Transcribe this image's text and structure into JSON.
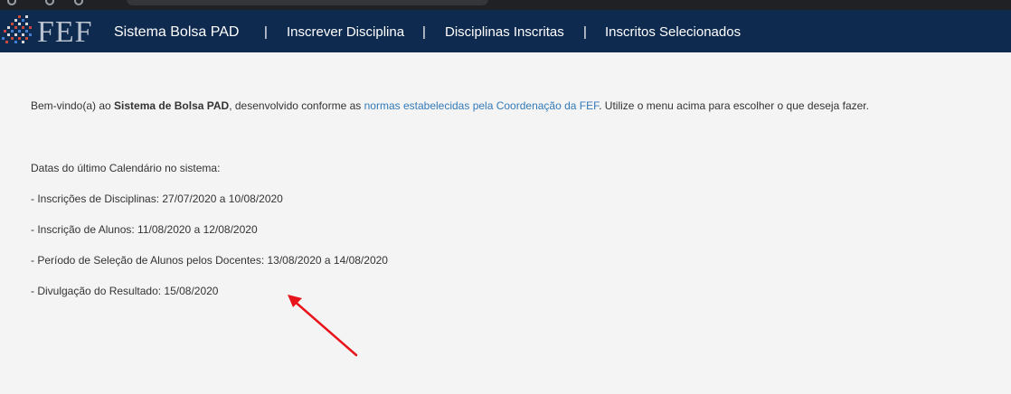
{
  "navbar": {
    "logo_text": "FEF",
    "brand": "Sistema Bolsa PAD",
    "separator": "|",
    "items": [
      {
        "label": "Inscrever Disciplina"
      },
      {
        "label": "Disciplinas Inscritas"
      },
      {
        "label": "Inscritos Selecionados"
      }
    ]
  },
  "welcome": {
    "prefix": "Bem-vindo(a) ao ",
    "system_name": "Sistema de Bolsa PAD",
    "middle": ", desenvolvido conforme as ",
    "link_text": "normas estabelecidas pela Coordenação da FEF",
    "suffix": ". Utilize o menu acima para escolher o que deseja fazer."
  },
  "calendar": {
    "heading": "Datas do último Calendário no sistema:",
    "entries": [
      "- Inscrições de Disciplinas: 27/07/2020 a 10/08/2020",
      "- Inscrição de Alunos: 11/08/2020 a 12/08/2020",
      "- Período de Seleção de Alunos pelos Docentes: 13/08/2020 a 14/08/2020",
      "- Divulgação do Resultado: 15/08/2020"
    ]
  },
  "colors": {
    "navbar_bg": "#0f2a4f",
    "link": "#337ab7",
    "annotation_arrow": "#e8141b"
  }
}
